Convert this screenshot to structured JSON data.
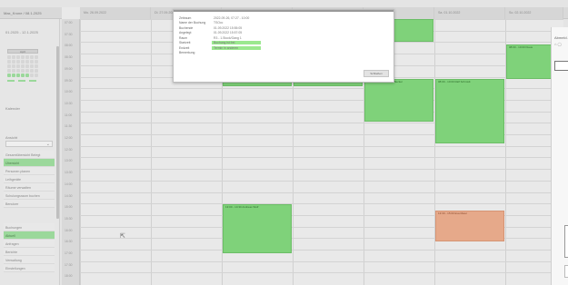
{
  "app": {
    "user_label": "Max_Krone / 08.1.2025"
  },
  "sidebar": {
    "date_range": "01.2025 - 12.1.2025",
    "minical_header": "April",
    "section_label_1": "Kalender",
    "section_label_2": "Ansicht",
    "list_a": [
      "Gesamtübersicht Belegt",
      "Übersicht",
      "Personen planen",
      "Leihgeräte",
      "Räume verwalten",
      "Schulungsraum buchen",
      "Benutzer"
    ],
    "list_a_active": 1,
    "list_b": [
      "Buchungen",
      "Aktuell",
      "Anfragen",
      "Berichte",
      "Verwaltung",
      "Einstellungen"
    ],
    "list_b_active": 1
  },
  "calendar": {
    "days": [
      "",
      "Mo. 26.09.2022",
      "Di. 27.09.2022",
      "Mi. 28.09.2022",
      "Do. 29.09.2022",
      "Fr. 30.09.2022",
      "Sa. 01.10.2022",
      "So. 02.10.2022"
    ],
    "times": [
      "07:00",
      "07:30",
      "08:00",
      "08:30",
      "09:00",
      "09:30",
      "10:00",
      "10:30",
      "11:00",
      "11:30",
      "12:00",
      "12:30",
      "13:00",
      "13:30",
      "14:00",
      "14:30",
      "15:00",
      "15:30",
      "16:00",
      "16:30",
      "17:00",
      "17:30",
      "18:00"
    ],
    "events": [
      {
        "col": 3,
        "row_start": 5.2,
        "row_end": 5.8,
        "label": ""
      },
      {
        "col": 4,
        "row_start": 5.2,
        "row_end": 5.8,
        "label": ""
      },
      {
        "col": 5,
        "row_start": 0,
        "row_end": 2.0,
        "label": ""
      },
      {
        "col": 5,
        "row_start": 5.2,
        "row_end": 8.9,
        "label": "08:00 - 10:00 Michael Becker"
      },
      {
        "col": 6,
        "row_start": 5.2,
        "row_end": 10.8,
        "label": "08:00 - 10:00 Ralf Schmidt"
      },
      {
        "col": 7,
        "row_start": 2.2,
        "row_end": 5.2,
        "label": "08:00 - 10:00 Klaus"
      },
      {
        "col": 3,
        "row_start": 16.1,
        "row_end": 20.3,
        "label": "13:00 - 14:30 Andreas Wolf"
      },
      {
        "col": 6,
        "row_start": 16.6,
        "row_end": 19.3,
        "label": "13:30 - 15:00 Eva Meier",
        "color": "orange"
      }
    ]
  },
  "popup": {
    "rows": [
      {
        "key": "Zeitraum",
        "value": "2022-09-26, 07:27 - 10:00"
      },
      {
        "key": "Name der Buchung",
        "value": "TSOcc"
      },
      {
        "key": "Buchende",
        "value": "01.09.2022 15:55:05"
      },
      {
        "key": "Angelegt",
        "value": "01.09.2022 15:57:05"
      },
      {
        "key": "Raum",
        "value": "R3 - 1.Stock/Gang 1"
      },
      {
        "key": "Startzeit",
        "value": "Buchung ist frei",
        "highlight": true
      },
      {
        "key": "Endzeit",
        "value": "Termin in anderen",
        "highlight": true
      },
      {
        "key": "Bemerkung",
        "value": ""
      }
    ],
    "close_label": "Schließen"
  },
  "right_panel": {
    "title": "Abmeld.",
    "icon_text": "⌂ ◯"
  }
}
